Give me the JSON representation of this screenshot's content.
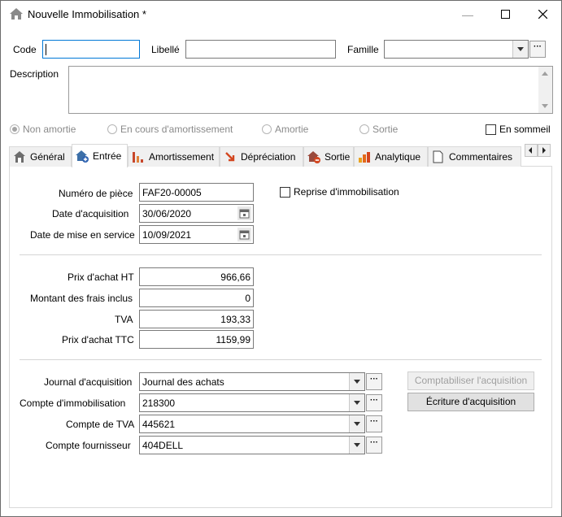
{
  "window": {
    "title": "Nouvelle Immobilisation *"
  },
  "header": {
    "code_label": "Code",
    "code_value": "",
    "libelle_label": "Libellé",
    "libelle_value": "",
    "famille_label": "Famille",
    "famille_value": "",
    "description_label": "Description",
    "description_value": ""
  },
  "status": {
    "radios": [
      {
        "label": "Non amortie",
        "selected": true
      },
      {
        "label": "En cours d'amortissement",
        "selected": false
      },
      {
        "label": "Amortie",
        "selected": false
      },
      {
        "label": "Sortie",
        "selected": false
      }
    ],
    "sommeil_label": "En sommeil",
    "sommeil_checked": false
  },
  "tabs": [
    {
      "label": "Général",
      "icon": "house-icon",
      "active": false
    },
    {
      "label": "Entrée",
      "icon": "house-plus-icon",
      "active": true
    },
    {
      "label": "Amortissement",
      "icon": "bar-chart-icon",
      "active": false
    },
    {
      "label": "Dépréciation",
      "icon": "down-arrow-icon",
      "active": false
    },
    {
      "label": "Sortie",
      "icon": "house-minus-icon",
      "active": false
    },
    {
      "label": "Analytique",
      "icon": "analytics-icon",
      "active": false
    },
    {
      "label": "Commentaires",
      "icon": "document-icon",
      "active": false
    }
  ],
  "entree": {
    "piece_label": "Numéro de pièce",
    "piece_value": "FAF20-00005",
    "reprise_label": "Reprise d'immobilisation",
    "reprise_checked": false,
    "date_acq_label": "Date d'acquisition",
    "date_acq_value": "30/06/2020",
    "date_service_label": "Date de mise en service",
    "date_service_value": "10/09/2021",
    "prix_ht_label": "Prix d'achat HT",
    "prix_ht_value": "966,66",
    "frais_label": "Montant des frais inclus",
    "frais_value": "0",
    "tva_label": "TVA",
    "tva_value": "193,33",
    "prix_ttc_label": "Prix d'achat TTC",
    "prix_ttc_value": "1159,99",
    "journal_label": "Journal d'acquisition",
    "journal_value": "Journal des achats",
    "compte_immo_label": "Compte d'immobilisation",
    "compte_immo_value": "218300",
    "compte_tva_label": "Compte de TVA",
    "compte_tva_value": "445621",
    "compte_fourn_label": "Compte fournisseur",
    "compte_fourn_value": "404DELL",
    "comptabiliser_label": "Comptabiliser l'acquisition",
    "ecriture_label": "Écriture d'acquisition"
  },
  "colors": {
    "accent": "#0078d7",
    "disabled": "#a0a0a0"
  }
}
